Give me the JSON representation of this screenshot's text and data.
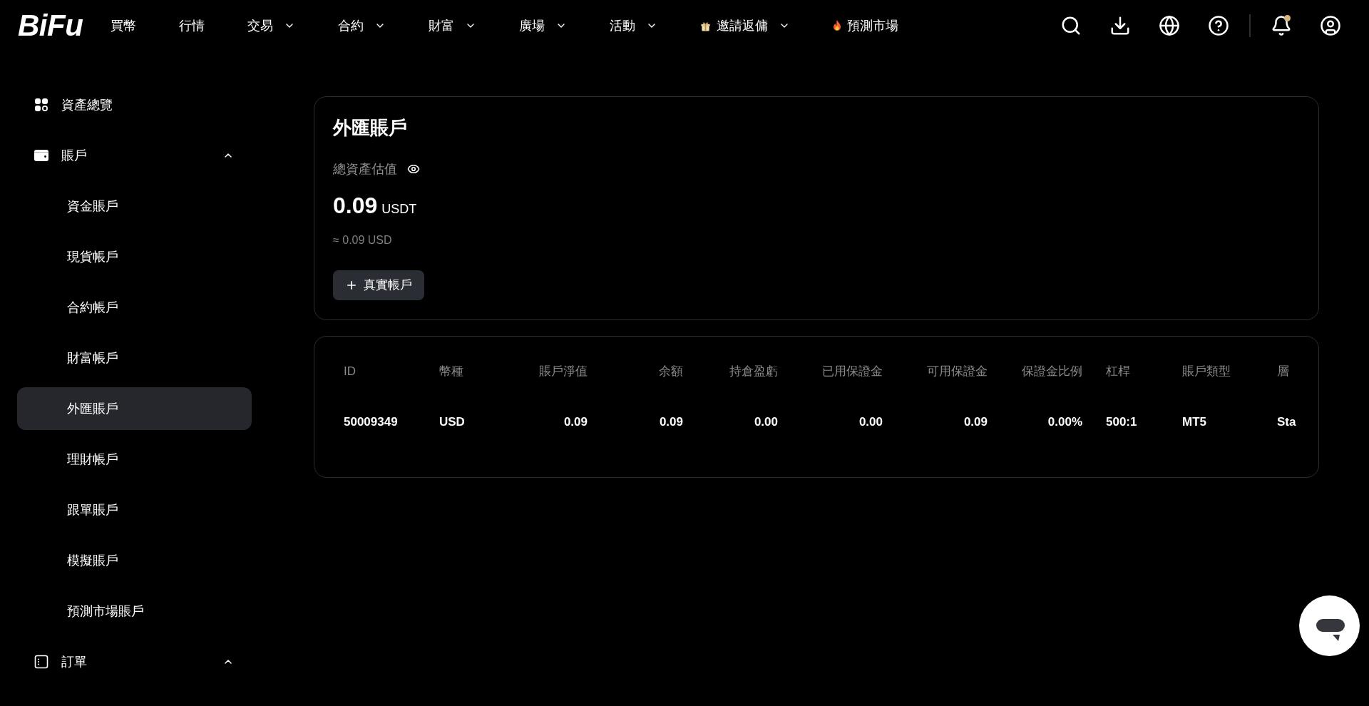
{
  "header": {
    "logo": "BiFu",
    "nav": [
      {
        "label": "買幣",
        "kind": "link"
      },
      {
        "label": "行情",
        "kind": "link"
      },
      {
        "label": "交易",
        "kind": "menu"
      },
      {
        "label": "合約",
        "kind": "menu"
      },
      {
        "label": "財富",
        "kind": "menu"
      },
      {
        "label": "廣場",
        "kind": "menu"
      },
      {
        "label": "活動",
        "kind": "menu"
      },
      {
        "label": "邀請返傭",
        "kind": "promo"
      },
      {
        "label": "預測市場",
        "kind": "hot"
      }
    ],
    "notifications_unread": true
  },
  "sidebar": {
    "items": [
      {
        "label": "資產總覽",
        "kind": "overview",
        "selected": false
      },
      {
        "label": "賬戶",
        "kind": "accounts",
        "selected": false,
        "expanded": true,
        "children": [
          {
            "label": "資金賬戶",
            "selected": false
          },
          {
            "label": "現貨帳戶",
            "selected": false
          },
          {
            "label": "合約帳戶",
            "selected": false
          },
          {
            "label": "財富帳戶",
            "selected": false
          },
          {
            "label": "外匯賬戶",
            "selected": true
          },
          {
            "label": "理財帳戶",
            "selected": false
          },
          {
            "label": "跟單賬戶",
            "selected": false
          },
          {
            "label": "模擬賬戶",
            "selected": false
          },
          {
            "label": "預測市場賬戶",
            "selected": false
          }
        ]
      },
      {
        "label": "訂單",
        "kind": "orders",
        "selected": false,
        "expanded": true
      }
    ]
  },
  "account_card": {
    "title": "外匯賬戶",
    "total_label": "總資產估值",
    "balance_visible": true,
    "total_value": "0.09",
    "total_unit": "USDT",
    "approx_value": "≈ 0.09 USD",
    "add_button": "真實帳戶"
  },
  "accounts_table": {
    "columns": [
      "ID",
      "幣種",
      "賬戶淨值",
      "余額",
      "持倉盈虧",
      "已用保證金",
      "可用保證金",
      "保證金比例",
      "杠桿",
      "賬戶類型",
      "層"
    ],
    "rows": [
      [
        "50009349",
        "USD",
        "0.09",
        "0.09",
        "0.00",
        "0.00",
        "0.09",
        "0.00%",
        "500:1",
        "MT5",
        "Sta"
      ]
    ]
  }
}
